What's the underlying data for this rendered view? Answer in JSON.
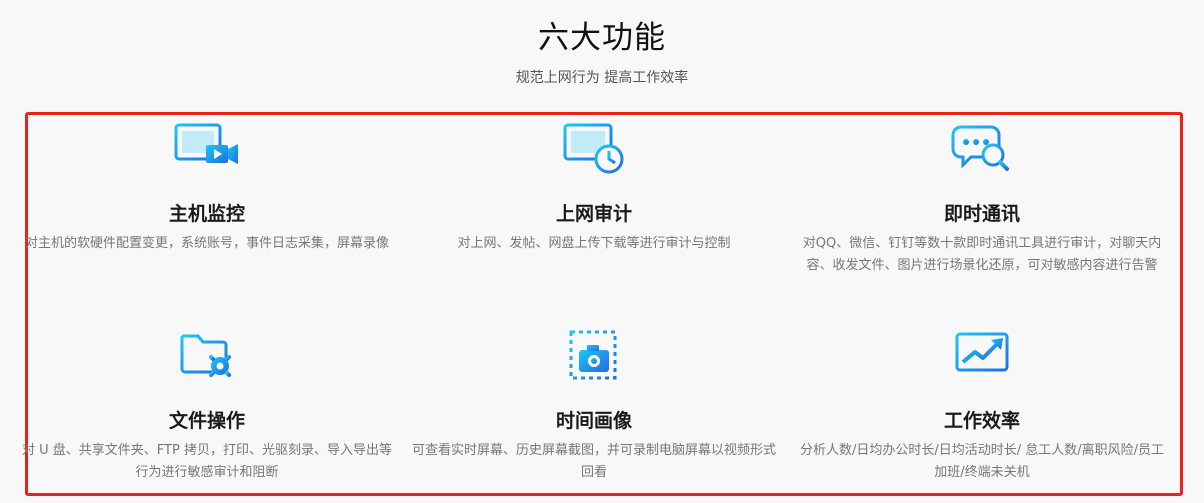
{
  "header": {
    "title": "六大功能",
    "subtitle": "规范上网行为 提高工作效率"
  },
  "colors": {
    "icon_gradient_start": "#1ec6f5",
    "icon_gradient_end": "#1f6fe0",
    "highlight_border": "#e8231a"
  },
  "features": [
    {
      "icon": "monitor-video-icon",
      "title": "主机监控",
      "desc": "对主机的软硬件配置变更，系统账号，事件日志采集，屏幕录像"
    },
    {
      "icon": "monitor-clock-icon",
      "title": "上网审计",
      "desc": "对上网、发帖、网盘上传下载等进行审计与控制"
    },
    {
      "icon": "chat-search-icon",
      "title": "即时通讯",
      "desc": "对QQ、微信、钉钉等数十款即时通讯工具进行审计，对聊天内容、收发文件、图片进行场景化还原，可对敏感内容进行告警"
    },
    {
      "icon": "folder-gear-icon",
      "title": "文件操作",
      "desc": "对 U 盘、共享文件夹、FTP 拷贝，打印、光驱刻录、导入导出等行为进行敏感审计和阻断"
    },
    {
      "icon": "camera-frame-icon",
      "title": "时间画像",
      "desc": "可查看实时屏幕、历史屏幕截图，并可录制电脑屏幕以视频形式回看"
    },
    {
      "icon": "monitor-trend-icon",
      "title": "工作效率",
      "desc": "分析人数/日均办公时长/日均活动时长/ 怠工人数/离职风险/员工加班/终端未关机"
    }
  ]
}
